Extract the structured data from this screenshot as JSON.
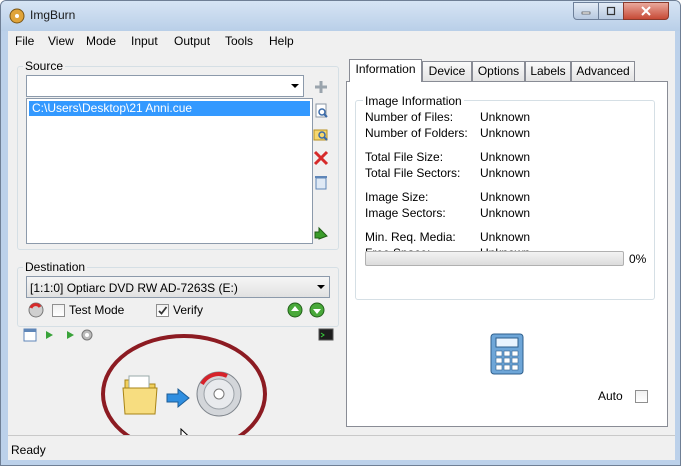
{
  "window": {
    "title": "ImgBurn"
  },
  "menu": [
    "File",
    "View",
    "Mode",
    "Input",
    "Output",
    "Tools",
    "Help"
  ],
  "source": {
    "label": "Source",
    "combo_value": "",
    "list_items": [
      "C:\\Users\\Desktop\\21 Anni.cue"
    ]
  },
  "destination": {
    "label": "Destination",
    "drive": "[1:1:0] Optiarc DVD RW AD-7263S (E:)",
    "test_mode": {
      "label": "Test Mode",
      "checked": false
    },
    "verify": {
      "label": "Verify",
      "checked": true
    }
  },
  "tabs": [
    "Information",
    "Device",
    "Options",
    "Labels",
    "Advanced"
  ],
  "info": {
    "group_title": "Image Information",
    "rows": [
      {
        "label": "Number of Files:",
        "value": "Unknown"
      },
      {
        "label": "Number of Folders:",
        "value": "Unknown"
      },
      {
        "label": "Total File Size:",
        "value": "Unknown"
      },
      {
        "label": "Total File Sectors:",
        "value": "Unknown"
      },
      {
        "label": "Image Size:",
        "value": "Unknown"
      },
      {
        "label": "Image Sectors:",
        "value": "Unknown"
      },
      {
        "label": "Min. Req. Media:",
        "value": "Unknown"
      },
      {
        "label": "Free Space:",
        "value": "Unknown"
      }
    ],
    "progress_percent": 0,
    "progress_text": "0%",
    "auto": {
      "label": "Auto",
      "checked": false
    }
  },
  "status": "Ready",
  "colors": {
    "selection": "#3399ff",
    "annotation": "#8c1b22",
    "progress": "#06b025"
  },
  "icons": {
    "sidebar": [
      "add-icon",
      "browse-file-icon",
      "browse-folder-icon",
      "delete-icon",
      "clear-icon",
      "move-icon"
    ],
    "destination": [
      "eject-icon",
      "drive-up-icon",
      "drive-down-icon"
    ],
    "main": [
      "folder-icon",
      "arrow-right-icon",
      "disc-icon",
      "calculator-icon"
    ]
  }
}
